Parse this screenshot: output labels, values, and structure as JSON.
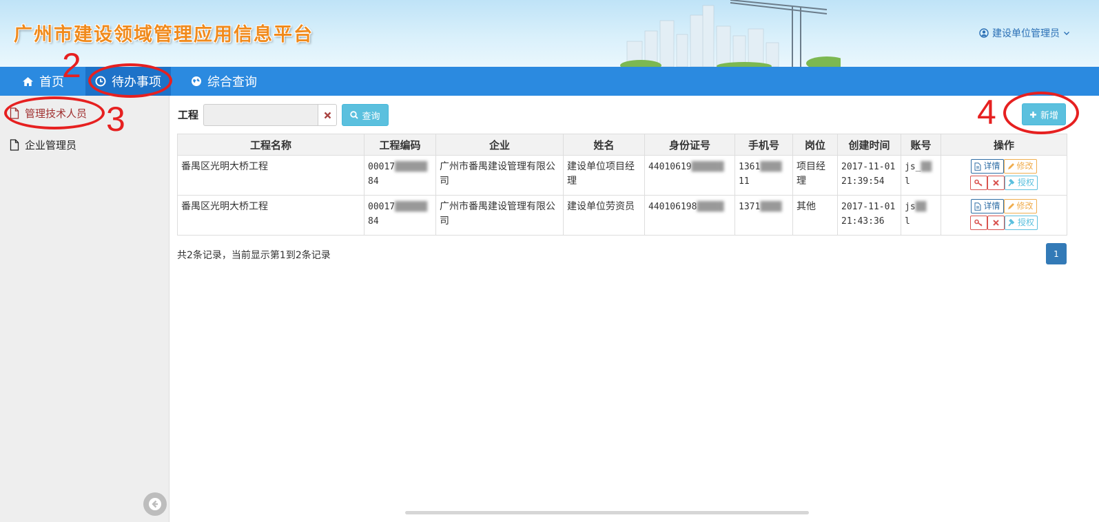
{
  "header": {
    "title": "广州市建设领域管理应用信息平台",
    "user": "建设单位管理员"
  },
  "nav": [
    {
      "label": "首页",
      "icon": "home-icon"
    },
    {
      "label": "待办事项",
      "icon": "clock-icon"
    },
    {
      "label": "综合查询",
      "icon": "globe-icon"
    }
  ],
  "sidebar": {
    "items": [
      {
        "label": "管理技术人员",
        "icon": "file-icon"
      },
      {
        "label": "企业管理员",
        "icon": "file-icon"
      }
    ]
  },
  "search": {
    "label": "工程",
    "value": "",
    "placeholder": "",
    "query_label": "查询",
    "add_label": "新增"
  },
  "table": {
    "columns": [
      "工程名称",
      "工程编码",
      "企业",
      "姓名",
      "身份证号",
      "手机号",
      "岗位",
      "创建时间",
      "账号",
      "操作"
    ],
    "rows": [
      {
        "project": "番禺区光明大桥工程",
        "code": "00017",
        "code_tail": "84",
        "company": "广州市番禺建设管理有限公司",
        "name": "建设单位项目经理",
        "id_no": "44010619",
        "phone": "1361",
        "phone_tail": "11",
        "position": "项目经理",
        "created": "2017-11-01 21:39:54",
        "account": "js_",
        "account_tail": "l"
      },
      {
        "project": "番禺区光明大桥工程",
        "code": "00017",
        "code_tail": "84",
        "company": "广州市番禺建设管理有限公司",
        "name": "建设单位劳资员",
        "id_no": "440106198",
        "phone": "1371",
        "phone_tail": "",
        "position": "其他",
        "created": "2017-11-01 21:43:36",
        "account": "js",
        "account_tail": "l"
      }
    ],
    "ops": {
      "detail": "详情",
      "edit": "修改",
      "grant": "授权"
    }
  },
  "footer": {
    "summary": "共2条记录，当前显示第1到2条记录",
    "page": "1"
  },
  "annotations": [
    "2",
    "3",
    "4"
  ],
  "colors": {
    "nav_bg": "#2b8ae0",
    "nav_active": "#1d72c8",
    "accent_info": "#5bc0de",
    "annotation_red": "#e62020",
    "pager": "#337ab7"
  }
}
